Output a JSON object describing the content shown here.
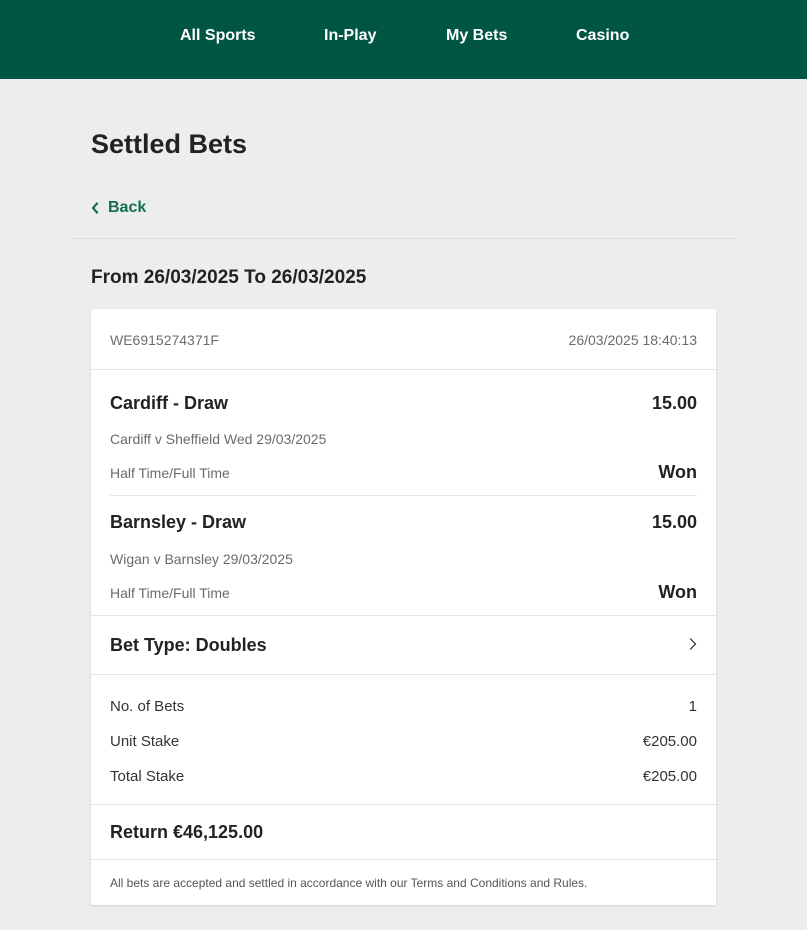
{
  "nav": {
    "items": [
      "All Sports",
      "In-Play",
      "My Bets",
      "Casino"
    ],
    "background": "#005643"
  },
  "page": {
    "title": "Settled Bets",
    "back_label": "Back",
    "date_range": "From 26/03/2025 To 26/03/2025"
  },
  "bet": {
    "reference": "WE6915274371F",
    "timestamp": "26/03/2025 18:40:13",
    "selections": [
      {
        "name": "Cardiff - Draw",
        "odds": "15.00",
        "event": "Cardiff v Sheffield Wed 29/03/2025",
        "market": "Half Time/Full Time",
        "result": "Won"
      },
      {
        "name": "Barnsley - Draw",
        "odds": "15.00",
        "event": "Wigan v Barnsley 29/03/2025",
        "market": "Half Time/Full Time",
        "result": "Won"
      }
    ],
    "bet_type": "Bet Type: Doubles",
    "summary": [
      {
        "label": "No. of Bets",
        "value": "1"
      },
      {
        "label": "Unit Stake",
        "value": "€205.00"
      },
      {
        "label": "Total Stake",
        "value": "€205.00"
      }
    ],
    "return": "Return €46,125.00",
    "terms": "All bets are accepted and settled in accordance with our Terms and Conditions and Rules."
  },
  "colors": {
    "brand": "#005643",
    "link": "#136d55",
    "page_bg": "#eceeed"
  },
  "icons": {
    "back": "chevron-left-icon",
    "bet_type": "chevron-right-icon"
  }
}
